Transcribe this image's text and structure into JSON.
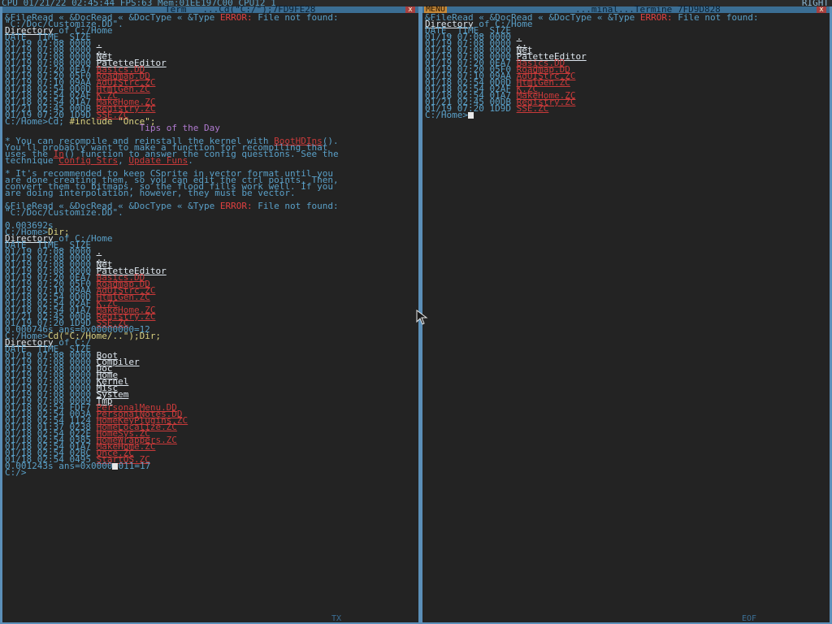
{
  "statusbar": {
    "sys_info": "CPU 01/21/22 02:45:44 FPS:63 Mem:01EE197C00 CPU12 1",
    "right": "RIGHT"
  },
  "left_window": {
    "title": "Term   ...Cd(\"C:/\");7FD9FE28",
    "close": "x",
    "bottom": "TX"
  },
  "right_window": {
    "menu": "MENU",
    "title": "...minal...Termine 7FD9D828",
    "close": "x",
    "bottom": "EOF"
  },
  "left_lines": [
    [
      [
        "&FileRead « &DocRead « &DocType « &Type ",
        "b"
      ],
      [
        "ERROR:",
        "e"
      ],
      [
        " File not found:",
        "b"
      ]
    ],
    [
      [
        "\"C:/Doc/Customize.DD\".",
        "b"
      ]
    ],
    [
      [
        "Directory",
        "w"
      ],
      [
        " of C:/Home",
        "b"
      ]
    ],
    [
      [
        "DATE_ TIME_ SIZE",
        "b"
      ]
    ],
    [
      [
        "01/19 07:08 0000 ",
        "b"
      ],
      [
        ".",
        "w"
      ]
    ],
    [
      [
        "01/19 07:08 0000 ",
        "b"
      ],
      [
        "..",
        "w"
      ]
    ],
    [
      [
        "01/19 07:08 0000 ",
        "b"
      ],
      [
        "Net",
        "w"
      ]
    ],
    [
      [
        "01/19 07:08 0000 ",
        "b"
      ],
      [
        "PaletteEditor",
        "w"
      ]
    ],
    [
      [
        "01/19 07:20 0EA7 ",
        "b"
      ],
      [
        "Basics.DD",
        "r"
      ]
    ],
    [
      [
        "01/19 07:20 05F0 ",
        "b"
      ],
      [
        "Roadmap.DD",
        "r"
      ]
    ],
    [
      [
        "01/19 07:10 09AA ",
        "b"
      ],
      [
        "AdUIStrc.ZC",
        "r"
      ]
    ],
    [
      [
        "01/18 02:54 0D0D ",
        "b"
      ],
      [
        "HtmlGen.ZC",
        "r"
      ]
    ],
    [
      [
        "01/18 02:54 02AF ",
        "b"
      ],
      [
        "K.ZC",
        "r"
      ]
    ],
    [
      [
        "01/18 02:54 01A7 ",
        "b"
      ],
      [
        "MakeHome.ZC",
        "r"
      ]
    ],
    [
      [
        "01/21 02:45 00DB ",
        "b"
      ],
      [
        "Registry.ZC",
        "r"
      ]
    ],
    [
      [
        "01/19 07:20 1D9D ",
        "b"
      ],
      [
        "SSE.ZC",
        "r"
      ]
    ],
    [
      [
        "C:/Home>Cd; ",
        "b"
      ],
      [
        "#include \"Once\";",
        "y"
      ]
    ],
    [
      [
        "                         ",
        "b"
      ],
      [
        "Tips of the Day",
        "p"
      ]
    ],
    [
      [
        "",
        "b"
      ]
    ],
    [
      [
        "* You can recompile and reinstall the kernel with ",
        "b"
      ],
      [
        "BootHDIns",
        "r"
      ],
      [
        "().",
        "b"
      ]
    ],
    [
      [
        "You'll probably want to make a function for recompiling that",
        "b"
      ]
    ],
    [
      [
        "uses the ",
        "b"
      ],
      [
        "In",
        "r"
      ],
      [
        "() function to answer the config questions. See the",
        "b"
      ]
    ],
    [
      [
        "technique ",
        "b"
      ],
      [
        "Config Strs",
        "r"
      ],
      [
        ", ",
        "b"
      ],
      [
        "Update Funs",
        "r"
      ],
      [
        ".",
        "b"
      ]
    ],
    [
      [
        "",
        "b"
      ]
    ],
    [
      [
        "* It's recommended to keep CSprite in vector format until you",
        "b"
      ]
    ],
    [
      [
        "are done creating them, so you can edit the ctrl points. Then,",
        "b"
      ]
    ],
    [
      [
        "convert them to bitmaps, so the flood fills work well. If you",
        "b"
      ]
    ],
    [
      [
        "are doing interpolation, however, they must be vector.",
        "b"
      ]
    ],
    [
      [
        "",
        "b"
      ]
    ],
    [
      [
        "&FileRead « &DocRead « &DocType « &Type ",
        "b"
      ],
      [
        "ERROR:",
        "e"
      ],
      [
        " File not found:",
        "b"
      ]
    ],
    [
      [
        "\"C:/Doc/Customize.DD\".",
        "b"
      ]
    ],
    [
      [
        "",
        "b"
      ]
    ],
    [
      [
        "0.003692s",
        "b"
      ]
    ],
    [
      [
        "C:/Home>",
        "b"
      ],
      [
        "Dir;",
        "y"
      ]
    ],
    [
      [
        "Directory",
        "w"
      ],
      [
        " of C:/Home",
        "b"
      ]
    ],
    [
      [
        "DATE_ TIME_ SIZE",
        "b"
      ]
    ],
    [
      [
        "01/19 07:08 0000 ",
        "b"
      ],
      [
        ".",
        "w"
      ]
    ],
    [
      [
        "01/19 07:08 0000 ",
        "b"
      ],
      [
        "..",
        "w"
      ]
    ],
    [
      [
        "01/19 07:08 0000 ",
        "b"
      ],
      [
        "Net",
        "w"
      ]
    ],
    [
      [
        "01/19 07:08 0000 ",
        "b"
      ],
      [
        "PaletteEditor",
        "w"
      ]
    ],
    [
      [
        "01/19 07:20 0EA7 ",
        "b"
      ],
      [
        "Basics.DD",
        "r"
      ]
    ],
    [
      [
        "01/19 07:20 05F0 ",
        "b"
      ],
      [
        "Roadmap.DD",
        "r"
      ]
    ],
    [
      [
        "01/19 07:10 09AA ",
        "b"
      ],
      [
        "AdUIStrc.ZC",
        "r"
      ]
    ],
    [
      [
        "01/18 02:54 0D0D ",
        "b"
      ],
      [
        "HtmlGen.ZC",
        "r"
      ]
    ],
    [
      [
        "01/18 02:54 02AF ",
        "b"
      ],
      [
        "K.ZC",
        "r"
      ]
    ],
    [
      [
        "01/18 02:54 01A7 ",
        "b"
      ],
      [
        "MakeHome.ZC",
        "r"
      ]
    ],
    [
      [
        "01/21 02:45 00DB ",
        "b"
      ],
      [
        "Registry.ZC",
        "r"
      ]
    ],
    [
      [
        "01/19 07:20 1D9D ",
        "b"
      ],
      [
        "SSE.ZC",
        "r"
      ]
    ],
    [
      [
        "0.000746s ans=0x00000000=12",
        "b"
      ]
    ],
    [
      [
        "C:/Home>",
        "b"
      ],
      [
        "Cd(\"C:/Home/..\");Dir;",
        "y"
      ]
    ],
    [
      [
        "Directory",
        "w"
      ],
      [
        " of C:/",
        "b"
      ]
    ],
    [
      [
        "DATE_ TIME_ SIZE",
        "b"
      ]
    ],
    [
      [
        "01/19 07:08 0000 ",
        "b"
      ],
      [
        "Boot",
        "w"
      ]
    ],
    [
      [
        "01/19 07:08 0000 ",
        "b"
      ],
      [
        "Compiler",
        "w"
      ]
    ],
    [
      [
        "01/19 07:08 0000 ",
        "b"
      ],
      [
        "Doc",
        "w"
      ]
    ],
    [
      [
        "01/19 07:08 0000 ",
        "b"
      ],
      [
        "Home",
        "w"
      ]
    ],
    [
      [
        "01/19 07:08 0000 ",
        "b"
      ],
      [
        "Kernel",
        "w"
      ]
    ],
    [
      [
        "01/19 07:08 0000 ",
        "b"
      ],
      [
        "Misc",
        "w"
      ]
    ],
    [
      [
        "01/19 07:08 0000 ",
        "b"
      ],
      [
        "System",
        "w"
      ]
    ],
    [
      [
        "01/19 07:08 0009 ",
        "b"
      ],
      [
        "Tmp",
        "w"
      ]
    ],
    [
      [
        "01/18 02:54 FDF7 ",
        "b"
      ],
      [
        "PersonalMenu.DD",
        "r"
      ]
    ],
    [
      [
        "01/18 02:54 003A ",
        "b"
      ],
      [
        "PersonalNotes.DD",
        "r"
      ]
    ],
    [
      [
        "01/18 02:54 1124 ",
        "b"
      ],
      [
        "HomeKeyPlugins.ZC",
        "r"
      ]
    ],
    [
      [
        "01/18 01:37 0238 ",
        "b"
      ],
      [
        "HomeLocalize.ZC",
        "r"
      ]
    ],
    [
      [
        "01/18 02:54 022E ",
        "b"
      ],
      [
        "HomeSys.ZC",
        "r"
      ]
    ],
    [
      [
        "01/18 02:54 0385 ",
        "b"
      ],
      [
        "HomeWrappers.ZC",
        "r"
      ]
    ],
    [
      [
        "01/18 02:54 01A7 ",
        "b"
      ],
      [
        "MakeHome.ZC",
        "r"
      ]
    ],
    [
      [
        "01/18 02:54 02BC ",
        "b"
      ],
      [
        "Once.ZC",
        "r"
      ]
    ],
    [
      [
        "01/18 02:54 0495 ",
        "b"
      ],
      [
        "StartOS.ZC",
        "r"
      ]
    ],
    [
      [
        "0.001243s ans=0x0000",
        "b"
      ],
      [
        "█",
        "c"
      ],
      [
        "011=17",
        "b"
      ]
    ],
    [
      [
        "C:/>",
        "b"
      ]
    ]
  ],
  "right_lines": [
    [
      [
        "&FileRead « &DocRead « &DocType « &Type ",
        "b"
      ],
      [
        "ERROR:",
        "e"
      ],
      [
        " File not found:",
        "b"
      ]
    ],
    [
      [
        "Directory",
        "w"
      ],
      [
        " of C:/Home",
        "b"
      ]
    ],
    [
      [
        "DATE_ TIME_ SIZE",
        "b"
      ]
    ],
    [
      [
        "01/19 07:08 0000 ",
        "b"
      ],
      [
        ".",
        "w"
      ]
    ],
    [
      [
        "01/19 07:08 0000 ",
        "b"
      ],
      [
        "..",
        "w"
      ]
    ],
    [
      [
        "01/19 07:08 0000 ",
        "b"
      ],
      [
        "Net",
        "w"
      ]
    ],
    [
      [
        "01/19 07:08 0000 ",
        "b"
      ],
      [
        "PaletteEditor",
        "w"
      ]
    ],
    [
      [
        "01/19 07:20 0EA7 ",
        "b"
      ],
      [
        "Basics.DD",
        "r"
      ]
    ],
    [
      [
        "01/19 07:20 05F0 ",
        "b"
      ],
      [
        "Roadmap.DD",
        "r"
      ]
    ],
    [
      [
        "01/19 07:10 09AA ",
        "b"
      ],
      [
        "AdUIStrc.ZC",
        "r"
      ]
    ],
    [
      [
        "01/18 02:54 0D0D ",
        "b"
      ],
      [
        "HtmlGen.ZC",
        "r"
      ]
    ],
    [
      [
        "01/18 02:54 02AF ",
        "b"
      ],
      [
        "K.ZC",
        "r"
      ]
    ],
    [
      [
        "01/18 02:54 01A7 ",
        "b"
      ],
      [
        "MakeHome.ZC",
        "r"
      ]
    ],
    [
      [
        "01/21 02:45 00DB ",
        "b"
      ],
      [
        "Registry.ZC",
        "r"
      ]
    ],
    [
      [
        "01/19 07:20 1D9D ",
        "b"
      ],
      [
        "SSE.ZC",
        "r"
      ]
    ],
    [
      [
        "C:/Home>",
        "b"
      ]
    ]
  ]
}
